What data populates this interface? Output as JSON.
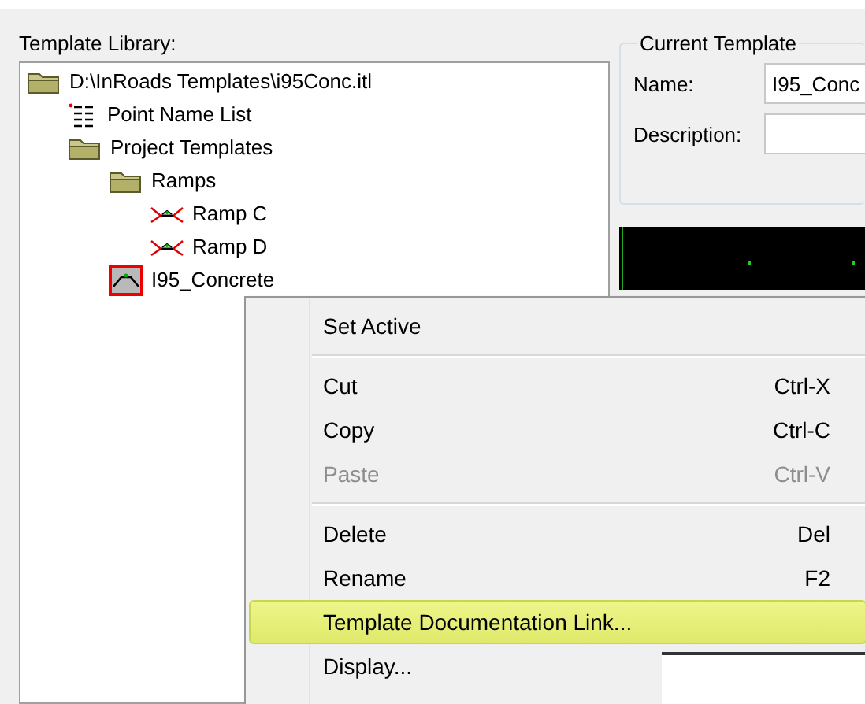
{
  "library": {
    "label": "Template Library:",
    "tree": [
      {
        "label": "D:\\InRoads Templates\\i95Conc.itl",
        "kind": "folder",
        "children": [
          {
            "label": "Point Name List",
            "kind": "list"
          },
          {
            "label": "Project Templates",
            "kind": "folder",
            "children": [
              {
                "label": "Ramps",
                "kind": "folder",
                "children": [
                  {
                    "label": "Ramp C",
                    "kind": "template",
                    "active": false
                  },
                  {
                    "label": "Ramp D",
                    "kind": "template",
                    "active": false
                  }
                ]
              },
              {
                "label": "I95_Concrete",
                "kind": "template",
                "active": true
              }
            ]
          }
        ]
      }
    ]
  },
  "current_template": {
    "title": "Current Template",
    "name_label": "Name:",
    "name_value": "I95_Conc",
    "description_label": "Description:"
  },
  "context_menu": {
    "items": [
      {
        "kind": "item",
        "label": "Set Active",
        "disabled": false,
        "selected": false
      },
      {
        "kind": "separator"
      },
      {
        "kind": "item",
        "label": "Cut",
        "shortcut": "Ctrl-X",
        "disabled": false,
        "selected": false
      },
      {
        "kind": "item",
        "label": "Copy",
        "shortcut": "Ctrl-C",
        "disabled": false,
        "selected": false
      },
      {
        "kind": "item",
        "label": "Paste",
        "shortcut": "Ctrl-V",
        "disabled": true,
        "selected": false
      },
      {
        "kind": "separator"
      },
      {
        "kind": "item",
        "label": "Delete",
        "shortcut": "Del",
        "disabled": false,
        "selected": false
      },
      {
        "kind": "item",
        "label": "Rename",
        "shortcut": "F2",
        "disabled": false,
        "selected": false
      },
      {
        "kind": "item",
        "label": "Template Documentation Link...",
        "disabled": false,
        "selected": true
      },
      {
        "kind": "item",
        "label": "Display...",
        "disabled": false,
        "selected": false
      }
    ]
  }
}
